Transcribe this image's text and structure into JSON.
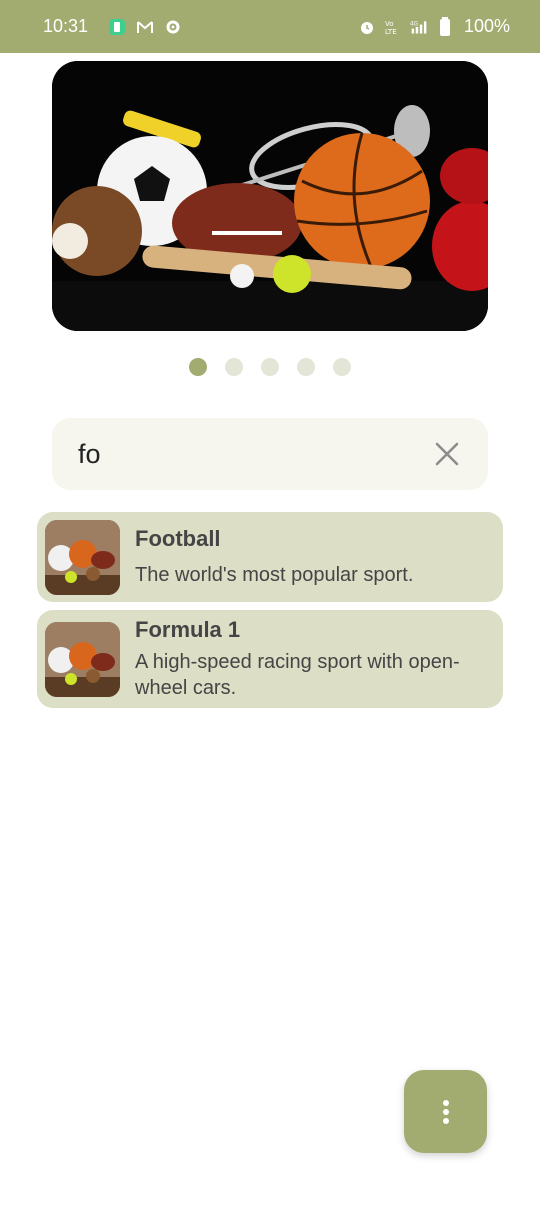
{
  "status_bar": {
    "time": "10:31",
    "battery": "100%",
    "icons": [
      "notification-app-icon",
      "gmail-icon",
      "settings-icon",
      "alarm-icon",
      "volte-icon",
      "signal-4g-icon",
      "battery-icon"
    ]
  },
  "carousel": {
    "image_description_icon": "sports-equipment-image",
    "page_count": 5,
    "active_index": 0
  },
  "search": {
    "value": "fo",
    "placeholder": ""
  },
  "results": [
    {
      "title": "Football",
      "description": "The world's most popular sport."
    },
    {
      "title": "Formula 1",
      "description": "A high-speed racing sport with open-wheel cars."
    }
  ],
  "fab": {
    "icon": "more-vert-icon"
  },
  "colors": {
    "accent": "#a2ab70",
    "card": "#dcdec6",
    "search_bg": "#f6f6ee",
    "dot_inactive": "#e3e5d7"
  }
}
